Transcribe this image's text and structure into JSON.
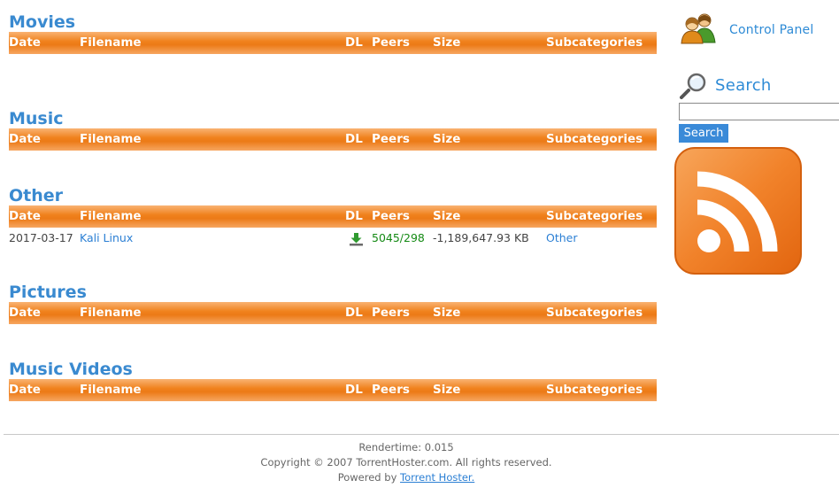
{
  "columns": {
    "date": "Date",
    "filename": "Filename",
    "dl": "DL",
    "peers": "Peers",
    "size": "Size",
    "subcategories": "Subcategories"
  },
  "sections": {
    "movies": {
      "title": "Movies"
    },
    "music": {
      "title": "Music"
    },
    "other": {
      "title": "Other",
      "rows": [
        {
          "date": "2017-03-17",
          "filename": "Kali Linux",
          "peers": "5045/298",
          "size": "-1,189,647.93 KB",
          "subcategory": "Other",
          "dl_icon": "download-arrow-icon"
        }
      ]
    },
    "pictures": {
      "title": "Pictures"
    },
    "music_videos": {
      "title": "Music Videos"
    }
  },
  "sidebar": {
    "control_panel_label": "Control Panel",
    "control_panel_icon": "users-icon",
    "search_title": "Search",
    "search_icon": "magnifier-icon",
    "search_value": "",
    "search_button": "Search",
    "rss_icon": "rss-feed-icon"
  },
  "footer": {
    "rendertime": "Rendertime: 0.015",
    "copyright": "Copyright © 2007 TorrentHoster.com. All rights reserved.",
    "powered_prefix": "Powered by",
    "powered_link": "Torrent Hoster."
  },
  "colors": {
    "accent_blue": "#3a8ad0",
    "header_orange": "#ef7f1a",
    "peers_green": "#158a15"
  }
}
